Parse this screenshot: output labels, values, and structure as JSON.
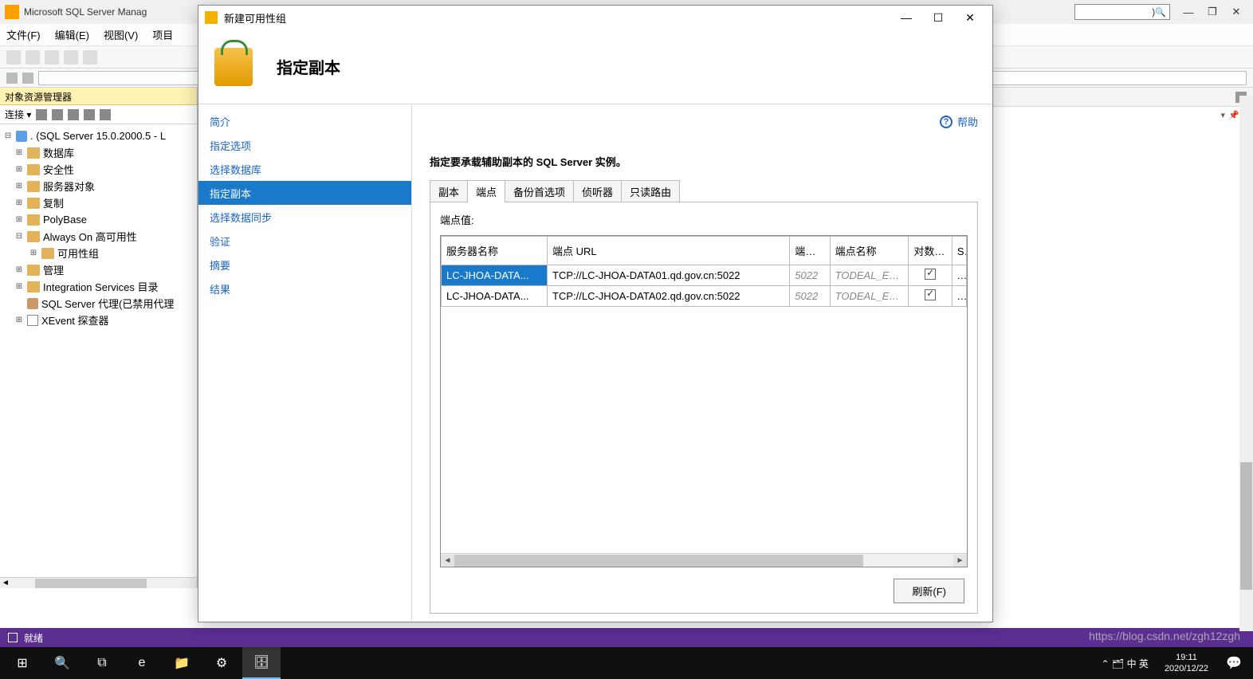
{
  "ssms": {
    "title": "Microsoft SQL Server Manag",
    "search_placeholder": ")",
    "menus": [
      "文件(F)",
      "编辑(E)",
      "视图(V)",
      "项目"
    ],
    "win_min": "—",
    "win_max": "❐",
    "win_close": "✕"
  },
  "explorer": {
    "header": "对象资源管理器",
    "connect": "连接 ▾",
    "root": ". (SQL Server 15.0.2000.5 - L",
    "nodes": {
      "db": "数据库",
      "security": "安全性",
      "server_obj": "服务器对象",
      "replication": "复制",
      "polybase": "PolyBase",
      "alwayson": "Always On 高可用性",
      "avail_group": "可用性组",
      "management": "管理",
      "integration": "Integration Services 目录",
      "agent": "SQL Server 代理(已禁用代理",
      "xevent": "XEvent 探查器"
    }
  },
  "modal": {
    "window_title": "新建可用性组",
    "win_min": "—",
    "win_max": "☐",
    "win_close": "✕",
    "header_title": "指定副本",
    "nav": {
      "intro": "简介",
      "options": "指定选项",
      "select_db": "选择数据库",
      "replicas": "指定副本",
      "data_sync": "选择数据同步",
      "validate": "验证",
      "summary": "摘要",
      "result": "结果"
    },
    "help": "帮助",
    "instruction": "指定要承载辅助副本的 SQL Server 实例。",
    "tabs": {
      "replica": "副本",
      "endpoint": "端点",
      "backup": "备份首选项",
      "listener": "侦听器",
      "readonly": "只读路由"
    },
    "endpoint_label": "端点值:",
    "columns": {
      "server_name": "服务器名称",
      "endpoint_url": "端点 URL",
      "port": "端口号",
      "endpoint_name": "端点名称",
      "encrypt": "对数据进行加密",
      "service": "S服"
    },
    "rows": [
      {
        "server": "LC-JHOA-DATA...",
        "url": "TCP://LC-JHOA-DATA01.qd.gov.cn:5022",
        "port": "5022",
        "epname": "TODEAL_Endpo",
        "svc": ".\\"
      },
      {
        "server": "LC-JHOA-DATA...",
        "url": "TCP://LC-JHOA-DATA02.qd.gov.cn:5022",
        "port": "5022",
        "epname": "TODEAL_Endpo",
        "svc": ".\\"
      }
    ],
    "refresh": "刷新(F)"
  },
  "status": "就绪",
  "taskbar": {
    "time": "19:11",
    "date": "2020/12/22",
    "tray": "⌃  🗂  中  英"
  },
  "watermark": "https://blog.csdn.net/zgh12zgh"
}
